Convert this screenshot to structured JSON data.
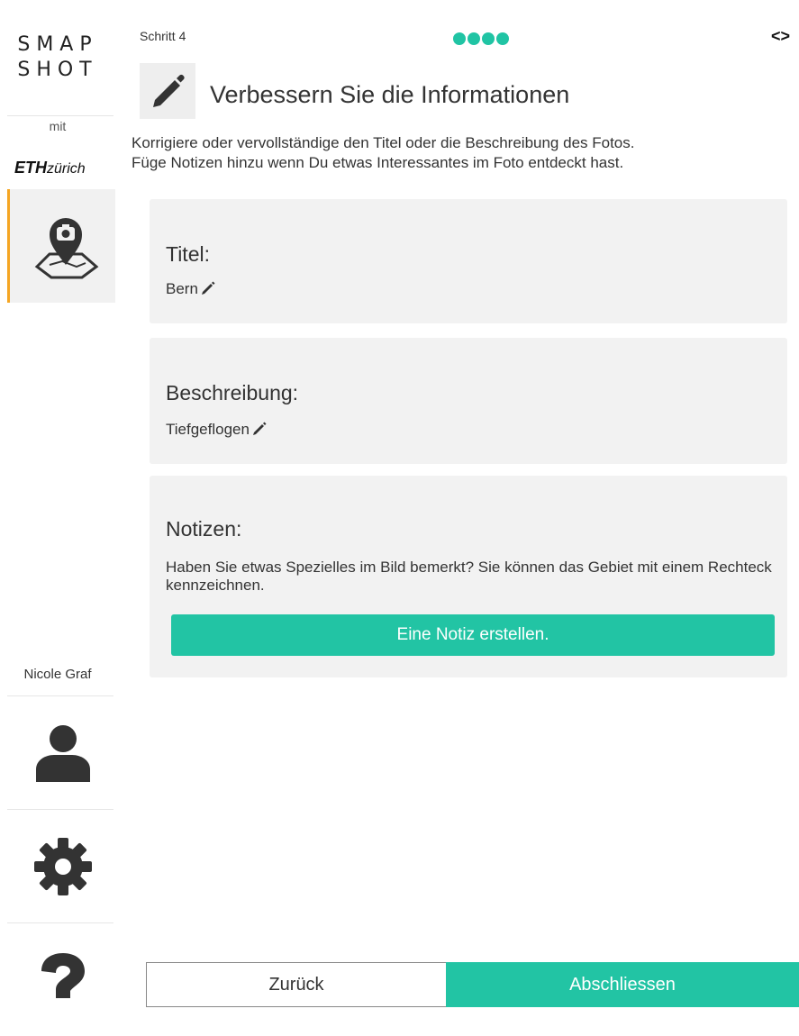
{
  "sidebar": {
    "brand_line1": "SMAP",
    "brand_line2": "SHOT",
    "with_label": "mit",
    "eth_logo": "ETH",
    "eth_suffix": "zürich",
    "user_name": "Nicole Graf",
    "icons": [
      "photo-map-icon",
      "user-icon",
      "gear-icon",
      "question-icon"
    ],
    "active_accent": "#f5a623"
  },
  "header": {
    "step_label": "Schritt 4",
    "progress_dots": 4,
    "nav_arrows": "<>"
  },
  "main": {
    "title": "Verbessern Sie die Informationen",
    "instructions_line1": "Korrigiere oder vervollständige den Titel oder die Beschreibung des Fotos.",
    "instructions_line2": "Füge Notizen hinzu wenn Du etwas Interessantes im Foto entdeckt hast.",
    "title_card": {
      "heading": "Titel:",
      "value": "Bern"
    },
    "description_card": {
      "heading": "Beschreibung:",
      "value": "Tiefgeflogen"
    },
    "notes_card": {
      "heading": "Notizen:",
      "text": "Haben Sie etwas Spezielles im Bild bemerkt? Sie können das Gebiet mit einem Rechteck kennzeichnen.",
      "button_label": "Eine Notiz erstellen."
    }
  },
  "footer": {
    "back_label": "Zurück",
    "finish_label": "Abschliessen"
  },
  "colors": {
    "accent": "#22c4a4",
    "card_bg": "#f2f2f2"
  }
}
